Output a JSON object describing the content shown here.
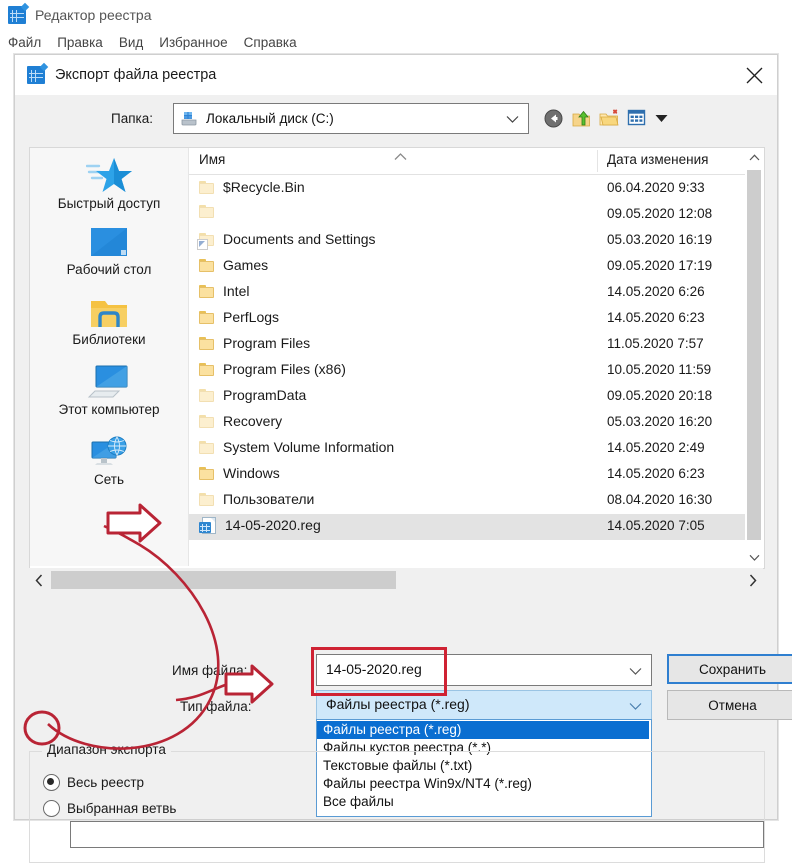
{
  "app": {
    "title": "Редактор реестра",
    "icon": "registry-editor-icon",
    "menu": [
      "Файл",
      "Правка",
      "Вид",
      "Избранное",
      "Справка"
    ]
  },
  "dialog": {
    "title": "Экспорт файла реестра",
    "icon": "registry-editor-icon",
    "close_glyph": "✕",
    "folder": {
      "label": "Папка:",
      "value": "Локальный диск (C:)",
      "drive_icon": "hard-drive-icon",
      "arrow": "chevron-down-icon"
    },
    "toolbar": [
      "back-icon",
      "up-folder-icon",
      "new-folder-icon",
      "views-icon"
    ],
    "places": [
      {
        "label": "Быстрый доступ",
        "icon": "quick-access-star-icon"
      },
      {
        "label": "Рабочий стол",
        "icon": "desktop-icon"
      },
      {
        "label": "Библиотеки",
        "icon": "libraries-folder-icon"
      },
      {
        "label": "Этот компьютер",
        "icon": "this-pc-icon"
      },
      {
        "label": "Сеть",
        "icon": "network-icon"
      }
    ],
    "columns": [
      "Имя",
      "Дата изменения"
    ],
    "sort_indicator": "caret-up-icon",
    "files": [
      {
        "name": "$Recycle.Bin",
        "date": "06.04.2020 9:33",
        "icon": "folder-icon",
        "dim": true,
        "selected": false
      },
      {
        "name": "",
        "date": "09.05.2020 12:08",
        "icon": "folder-icon",
        "dim": true,
        "selected": false
      },
      {
        "name": "Documents and Settings",
        "date": "05.03.2020 16:19",
        "icon": "folder-shortcut-icon",
        "dim": true,
        "selected": false
      },
      {
        "name": "Games",
        "date": "09.05.2020 17:19",
        "icon": "folder-icon",
        "dim": false,
        "selected": false
      },
      {
        "name": "Intel",
        "date": "14.05.2020 6:26",
        "icon": "folder-icon",
        "dim": false,
        "selected": false
      },
      {
        "name": "PerfLogs",
        "date": "14.05.2020 6:23",
        "icon": "folder-icon",
        "dim": false,
        "selected": false
      },
      {
        "name": "Program Files",
        "date": "11.05.2020 7:57",
        "icon": "folder-icon",
        "dim": false,
        "selected": false
      },
      {
        "name": "Program Files (x86)",
        "date": "10.05.2020 11:59",
        "icon": "folder-icon",
        "dim": false,
        "selected": false
      },
      {
        "name": "ProgramData",
        "date": "09.05.2020 20:18",
        "icon": "folder-icon",
        "dim": true,
        "selected": false
      },
      {
        "name": "Recovery",
        "date": "05.03.2020 16:20",
        "icon": "folder-icon",
        "dim": true,
        "selected": false
      },
      {
        "name": "System Volume Information",
        "date": "14.05.2020 2:49",
        "icon": "folder-icon",
        "dim": true,
        "selected": false
      },
      {
        "name": "Windows",
        "date": "14.05.2020 6:23",
        "icon": "folder-icon",
        "dim": false,
        "selected": false
      },
      {
        "name": "Пользователи",
        "date": "08.04.2020 16:30",
        "icon": "folder-icon",
        "dim": true,
        "selected": false
      },
      {
        "name": "14-05-2020.reg",
        "date": "14.05.2020 7:05",
        "icon": "reg-file-icon",
        "dim": false,
        "selected": true
      }
    ],
    "filename": {
      "label": "Имя файла:",
      "value": "14-05-2020.reg",
      "arrow": "chevron-down-icon"
    },
    "filetype": {
      "label": "Тип файла:",
      "value": "Файлы реестра (*.reg)",
      "arrow": "chevron-down-icon",
      "options": [
        "Файлы реестра (*.reg)",
        "Файлы кустов реестра (*.*)",
        "Текстовые файлы (*.txt)",
        "Файлы реестра Win9x/NT4 (*.reg)",
        "Все файлы"
      ],
      "selected_index": 0
    },
    "buttons": {
      "save": "Сохранить",
      "cancel": "Отмена"
    },
    "range": {
      "legend": "Диапазон экспорта",
      "options": [
        {
          "label": "Весь реестр",
          "checked": true
        },
        {
          "label": "Выбранная ветвь",
          "checked": false
        }
      ],
      "branch_value": ""
    },
    "scroll": {
      "v_up": "chevron-up-icon",
      "v_down": "chevron-down-icon",
      "h_left": "chevron-left-icon",
      "h_right": "chevron-right-icon"
    }
  },
  "annotations": {
    "color": "#c0202f",
    "highlight_color": "#cf2233",
    "shapes": [
      "arrow-to-network-place",
      "arrow-to-filetype-option",
      "curve-radio-to-arrow",
      "rect-around-filename",
      "ellipse-around-radio"
    ]
  }
}
